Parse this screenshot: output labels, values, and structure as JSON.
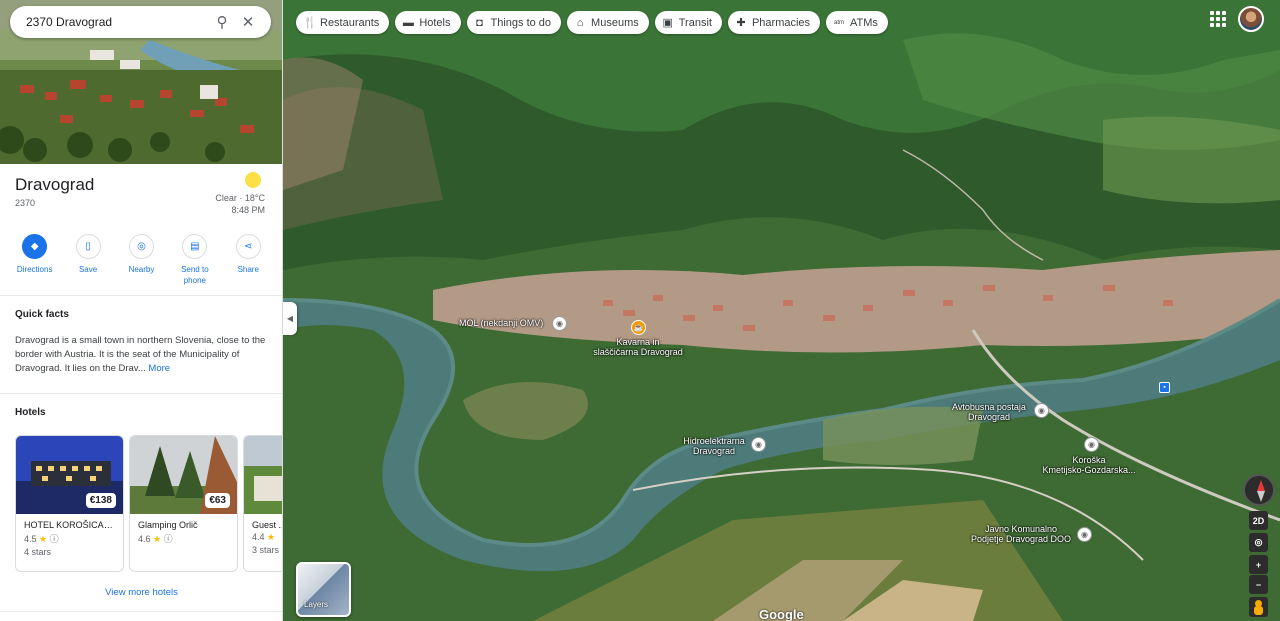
{
  "search": {
    "value": "2370 Dravograd"
  },
  "place": {
    "title": "Dravograd",
    "postal": "2370",
    "weather": {
      "condition": "Clear · 18°C",
      "time": "8:48 PM",
      "icon": "sun-icon"
    }
  },
  "actions": [
    {
      "label": "Directions",
      "icon": "directions-icon"
    },
    {
      "label": "Save",
      "icon": "bookmark-icon"
    },
    {
      "label": "Nearby",
      "icon": "nearby-icon"
    },
    {
      "label": "Send to phone",
      "label_line1": "Send to",
      "label_line2": "phone",
      "icon": "phone-icon"
    },
    {
      "label": "Share",
      "icon": "share-icon"
    }
  ],
  "quick_facts": {
    "heading": "Quick facts",
    "text": "Dravograd is a small town in northern Slovenia, close to the border with Austria. It is the seat of the Municipality of Dravograd. It lies on the Drav...",
    "more": "More"
  },
  "hotels": {
    "heading": "Hotels",
    "items": [
      {
        "name": "HOTEL KOROŠICA, ...",
        "price": "€138",
        "rating": "4.5",
        "stars": "4 stars"
      },
      {
        "name": "Glamping Orlič",
        "price": "€63",
        "rating": "4.6",
        "stars": ""
      },
      {
        "name": "Guest ...",
        "price": "",
        "rating": "4.4",
        "stars": "3 stars"
      }
    ],
    "view_more": "View more hotels"
  },
  "map": {
    "chips": [
      {
        "label": "Restaurants",
        "icon": "fork-knife-icon"
      },
      {
        "label": "Hotels",
        "icon": "bed-icon"
      },
      {
        "label": "Things to do",
        "icon": "camera-icon"
      },
      {
        "label": "Museums",
        "icon": "museum-icon"
      },
      {
        "label": "Transit",
        "icon": "train-icon"
      },
      {
        "label": "Pharmacies",
        "icon": "pharmacy-icon"
      },
      {
        "label": "ATMs",
        "icon": "atm-icon"
      }
    ],
    "labels": {
      "mol": "MOL (nekdanji OMV)",
      "kavarna_1": "Kavarna in",
      "kavarna_2": "slaščičarna Dravograd",
      "hidro_1": "Hidroelektrarna",
      "hidro_2": "Dravograd",
      "avtobus_1": "Avtobusna postaja",
      "avtobus_2": "Dravograd",
      "koroska_1": "Koroška",
      "koroska_2": "Kmetijsko-Gozdarska...",
      "javno_1": "Javno Komunalno",
      "javno_2": "Podjetje Dravograd DOO"
    },
    "layers_label": "Layers",
    "toggle_2d": "2D",
    "zoom_in": "+",
    "zoom_out": "−",
    "attribution": "Google"
  }
}
